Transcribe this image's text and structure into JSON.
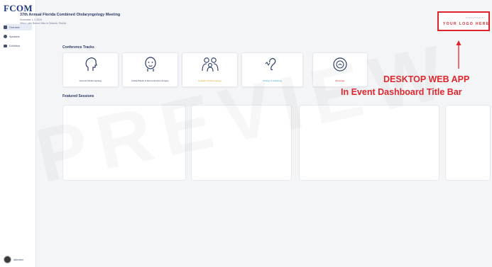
{
  "sidebar": {
    "brand": "FCOM",
    "items": [
      {
        "label": "Overview",
        "icon": "grid-icon",
        "active": true
      },
      {
        "label": "Speakers",
        "icon": "people-icon",
        "active": false
      },
      {
        "label": "Exhibitors",
        "icon": "list-icon",
        "active": false
      }
    ],
    "user": {
      "name": "Attendee"
    }
  },
  "event": {
    "title": "37th Annual Florida Combined Otolaryngology Meeting",
    "date": "November 1-3, 2024",
    "venue": "Hilton Lake Buena Vista in Orlando, Florida"
  },
  "tracks": {
    "heading": "Conference Tracks",
    "items": [
      {
        "label": "General Otolaryngology",
        "icon": "head-profile-icon",
        "color": "#2b3a67"
      },
      {
        "label": "Facial Plastic & Reconstructive Surgery",
        "icon": "face-icon",
        "color": "#2b3a67"
      },
      {
        "label": "Pediatric Otolaryngology",
        "icon": "family-icon",
        "color": "#e0a21b"
      },
      {
        "label": "Otology & Audiology",
        "icon": "ear-icon",
        "color": "#2aa8c9"
      },
      {
        "label": "Rhinology",
        "icon": "nose-icon",
        "color": "#e0242b"
      }
    ]
  },
  "featured": {
    "heading": "Featured Sessions"
  },
  "sponsor": {
    "caption": "PRESENTED BY",
    "logo_text": "YOUR LOGO HERE"
  },
  "annotation": {
    "line1": "DESKTOP WEB APP",
    "line2": "In Event Dashboard Title Bar"
  },
  "watermark": "PREVIEW",
  "colors": {
    "accent": "#e0242b",
    "primary": "#2b3a67",
    "background": "#f4f5f7"
  }
}
